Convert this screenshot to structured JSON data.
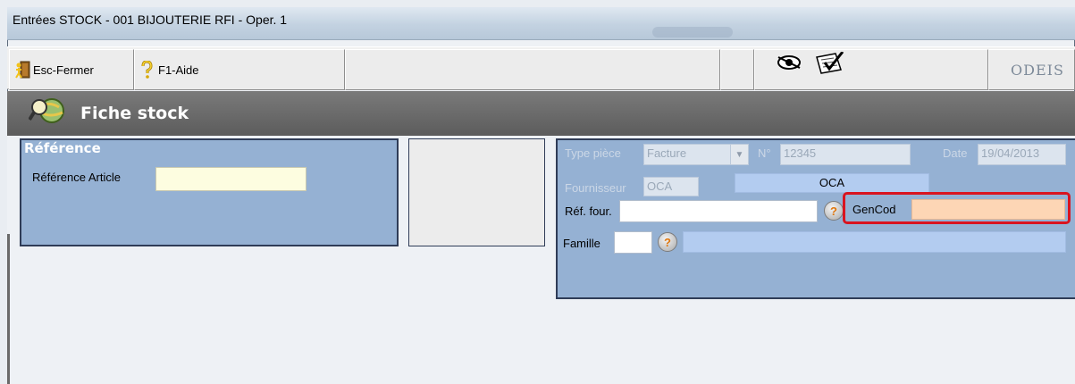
{
  "window": {
    "title": "Entrées STOCK - 001 BIJOUTERIE RFI - Oper. 1"
  },
  "toolbar": {
    "close_label": "Esc-Fermer",
    "help_label": "F1-Aide",
    "logo_text": "ODEIS",
    "icons": [
      "exit-door-icon",
      "question-mark-icon",
      "eye-icon",
      "checklist-icon"
    ]
  },
  "header": {
    "title": "Fiche stock"
  },
  "reference": {
    "section_title": "Référence",
    "article_label": "Référence Article",
    "article_value": ""
  },
  "document": {
    "type_label": "Type pièce",
    "type_value": "Facture",
    "number_label": "N°",
    "number_value": "12345",
    "date_label": "Date",
    "date_value": "19/04/2013",
    "supplier_label": "Fournisseur",
    "supplier_code": "OCA",
    "supplier_name": "OCA",
    "ref_four_label": "Réf. four.",
    "ref_four_value": "",
    "gencod_label": "GenCod",
    "gencod_value": "",
    "famille_label": "Famille",
    "famille_code": "",
    "famille_name": ""
  },
  "colors": {
    "panel_blue": "#95b1d3",
    "header_gray": "#5c5c5c",
    "highlight_red": "#d9141f",
    "gencod_field": "#fdd6b5"
  }
}
